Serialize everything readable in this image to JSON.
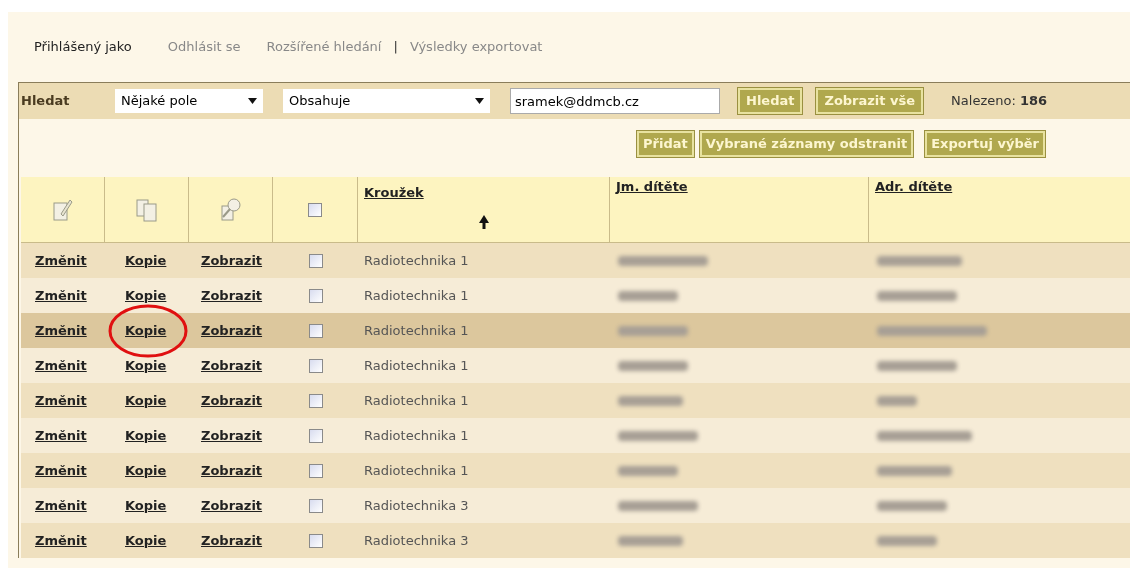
{
  "top_links": [
    {
      "label": "Přihlášený jako",
      "kind": "text"
    },
    {
      "label": "Odhlásit se",
      "kind": "link"
    },
    {
      "label": "Rozšířené hledání",
      "kind": "link"
    },
    {
      "label": "|",
      "kind": "separator"
    },
    {
      "label": "Výsledky exportovat",
      "kind": "link"
    }
  ],
  "search": {
    "label": "Hledat",
    "field_select": "Nějaké pole",
    "operator_select": "Obsahuje",
    "value": "sramek@ddmcb.cz",
    "buttons": [
      "Hledat",
      "Zobrazit vše"
    ],
    "found_label": "Nalezeno:",
    "found_count": "186"
  },
  "actions": [
    "Přidat",
    "Vybrané záznamy odstranit",
    "Exportuj výběr"
  ],
  "table": {
    "select_all_checked": false,
    "columns": [
      {
        "label": "Kroužek",
        "sorted": true
      },
      {
        "label": "Jm. dítěte",
        "sorted": false
      },
      {
        "label": "Adr. dítěte",
        "sorted": false
      }
    ],
    "rows": [
      {
        "edit": "Změnit",
        "copy": "Kopie",
        "view": "Zobrazit",
        "checked": false,
        "selected": false,
        "circled": false,
        "club": "Radiotechnika 1"
      },
      {
        "edit": "Změnit",
        "copy": "Kopie",
        "view": "Zobrazit",
        "checked": false,
        "selected": false,
        "circled": false,
        "club": "Radiotechnika 1"
      },
      {
        "edit": "Změnit",
        "copy": "Kopie",
        "view": "Zobrazit",
        "checked": false,
        "selected": true,
        "circled": true,
        "club": "Radiotechnika 1"
      },
      {
        "edit": "Změnit",
        "copy": "Kopie",
        "view": "Zobrazit",
        "checked": false,
        "selected": false,
        "circled": false,
        "club": "Radiotechnika 1"
      },
      {
        "edit": "Změnit",
        "copy": "Kopie",
        "view": "Zobrazit",
        "checked": false,
        "selected": false,
        "circled": false,
        "club": "Radiotechnika 1"
      },
      {
        "edit": "Změnit",
        "copy": "Kopie",
        "view": "Zobrazit",
        "checked": false,
        "selected": false,
        "circled": false,
        "club": "Radiotechnika 1"
      },
      {
        "edit": "Změnit",
        "copy": "Kopie",
        "view": "Zobrazit",
        "checked": false,
        "selected": false,
        "circled": false,
        "club": "Radiotechnika 1"
      },
      {
        "edit": "Změnit",
        "copy": "Kopie",
        "view": "Zobrazit",
        "checked": false,
        "selected": false,
        "circled": false,
        "club": "Radiotechnika 3"
      },
      {
        "edit": "Změnit",
        "copy": "Kopie",
        "view": "Zobrazit",
        "checked": false,
        "selected": false,
        "circled": false,
        "club": "Radiotechnika 3"
      }
    ]
  }
}
